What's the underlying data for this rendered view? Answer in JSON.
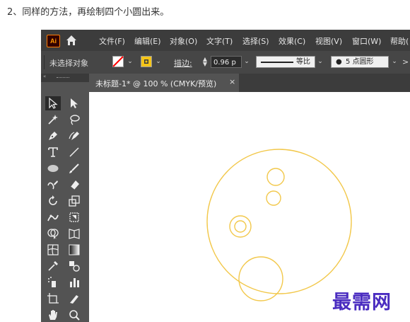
{
  "caption": "2、同样的方法，再绘制四个小圆出来。",
  "app": {
    "logo": "Ai",
    "menu": [
      "文件(F)",
      "编辑(E)",
      "对象(O)",
      "文字(T)",
      "选择(S)",
      "效果(C)",
      "视图(V)",
      "窗口(W)",
      "帮助("
    ],
    "control": {
      "selection_status": "未选择对象",
      "stroke_label": "描边:",
      "stroke_weight": "0.96 p",
      "profile_label": "等比",
      "brush_label": "5 点圆形",
      "stroke_color": "#ff0000",
      "fill_color": "#f5c518"
    },
    "panel_collapse": "«",
    "tab": {
      "title": "未标题-1* @ 100 % (CMYK/预览)",
      "close": "×"
    },
    "tools": [
      "selection-tool",
      "direct-selection-tool",
      "magic-wand-tool",
      "lasso-tool",
      "pen-tool",
      "curvature-tool",
      "type-tool",
      "line-tool",
      "ellipse-tool",
      "paintbrush-tool",
      "shaper-tool",
      "eraser-tool",
      "rotate-tool",
      "scale-tool",
      "puppet-warp-tool",
      "free-transform-tool",
      "shape-builder-tool",
      "perspective-grid-tool",
      "mesh-tool",
      "gradient-tool",
      "eyedropper-tool",
      "blend-tool",
      "symbol-sprayer-tool",
      "column-graph-tool",
      "artboard-tool",
      "slice-tool",
      "hand-tool",
      "zoom-tool"
    ],
    "circle_color": "#f2c84b"
  },
  "watermark": "最需网"
}
